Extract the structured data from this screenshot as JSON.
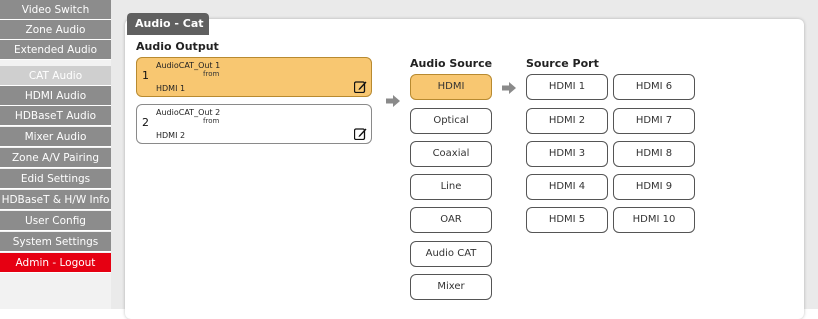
{
  "sidebar": {
    "items": [
      {
        "label": "Video Switch"
      },
      {
        "label": "Zone Audio"
      },
      {
        "label": "Extended Audio"
      },
      {
        "label": "CAT Audio",
        "active": true
      },
      {
        "label": "HDMI Audio"
      },
      {
        "label": "HDBaseT Audio"
      },
      {
        "label": "Mixer Audio"
      },
      {
        "label": "Zone A/V Pairing"
      },
      {
        "label": "Edid Settings"
      },
      {
        "label": "HDBaseT & H/W Info"
      },
      {
        "label": "User Config"
      },
      {
        "label": "System Settings"
      },
      {
        "label": "Admin - Logout"
      }
    ]
  },
  "page": {
    "title": "Audio - Cat"
  },
  "audio_output": {
    "label": "Audio Output",
    "outputs": [
      {
        "number": "1",
        "name": "AudioCAT_Out 1",
        "from_label": "from",
        "source": "HDMI 1",
        "selected": true
      },
      {
        "number": "2",
        "name": "AudioCAT_Out 2",
        "from_label": "from",
        "source": "HDMI 2",
        "selected": false
      }
    ]
  },
  "audio_source": {
    "label": "Audio Source",
    "items": [
      {
        "label": "HDMI",
        "selected": true
      },
      {
        "label": "Optical"
      },
      {
        "label": "Coaxial"
      },
      {
        "label": "Line"
      },
      {
        "label": "OAR"
      },
      {
        "label": "Audio CAT"
      },
      {
        "label": "Mixer"
      }
    ]
  },
  "source_port": {
    "label": "Source Port",
    "ports": [
      {
        "label": "HDMI 1"
      },
      {
        "label": "HDMI 6"
      },
      {
        "label": "HDMI 2"
      },
      {
        "label": "HDMI 7"
      },
      {
        "label": "HDMI 3"
      },
      {
        "label": "HDMI 8"
      },
      {
        "label": "HDMI 4"
      },
      {
        "label": "HDMI 9"
      },
      {
        "label": "HDMI 5"
      },
      {
        "label": "HDMI 10"
      }
    ]
  },
  "colors": {
    "selected": "#f8c771",
    "nav": "#8c8c8c",
    "nav_active": "#cfcfcf",
    "logout": "#e60012",
    "title_tab": "#606060"
  }
}
